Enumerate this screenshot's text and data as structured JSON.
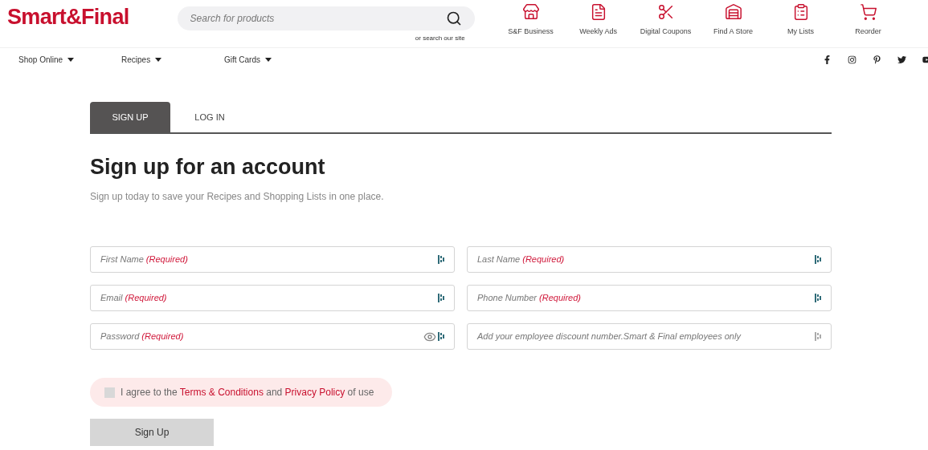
{
  "header": {
    "logo": "Smart&Final",
    "search": {
      "placeholder": "Search for products",
      "sub_link": "or search our site"
    },
    "quick_links": [
      {
        "label": "S&F Business",
        "kind": "business"
      },
      {
        "label": "Weekly Ads",
        "kind": "ads"
      },
      {
        "label": "Digital Coupons",
        "kind": "coupons"
      },
      {
        "label": "Find A Store",
        "kind": "store"
      },
      {
        "label": "My Lists",
        "kind": "lists"
      },
      {
        "label": "Reorder",
        "kind": "reorder"
      }
    ]
  },
  "nav": {
    "items": [
      "Shop Online",
      "Recipes",
      "Gift Cards"
    ]
  },
  "tabs": [
    {
      "label": "SIGN UP",
      "selected": true
    },
    {
      "label": "LOG IN",
      "selected": false
    }
  ],
  "title": "Sign up for an account",
  "subtitle": "Sign up today to save your Recipes and Shopping Lists in one place.",
  "fields": [
    {
      "placeholder": "First Name",
      "required": "(Required)",
      "kind": "text"
    },
    {
      "placeholder": "Last Name",
      "required": "(Required)",
      "kind": "text"
    },
    {
      "placeholder": "Email",
      "required": "(Required)",
      "kind": "text"
    },
    {
      "placeholder": "Phone Number",
      "required": "(Required)",
      "kind": "text"
    },
    {
      "placeholder": "Password",
      "required": "(Required)",
      "kind": "password"
    },
    {
      "placeholder": "Add your employee discount number.Smart & Final employees only",
      "kind": "text"
    }
  ],
  "agreement": {
    "checked": false,
    "parts": [
      {
        "text": "I agree to the ",
        "kind": "text"
      },
      {
        "text": "Terms & Conditions",
        "kind": "link"
      },
      {
        "text": " and ",
        "kind": "text"
      },
      {
        "text": "Privacy Policy",
        "kind": "link"
      },
      {
        "text": " of use",
        "kind": "text"
      }
    ]
  },
  "submit": {
    "label": "Sign Up",
    "disabled": true
  }
}
